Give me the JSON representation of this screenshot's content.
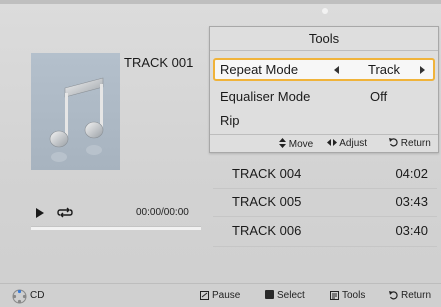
{
  "now_playing": {
    "track_title": "TRACK 001",
    "time": "00:00/00:00",
    "progress": 0
  },
  "tracks": [
    {
      "name": "TRACK 004",
      "duration": "04:02"
    },
    {
      "name": "TRACK 005",
      "duration": "03:43"
    },
    {
      "name": "TRACK 006",
      "duration": "03:40"
    }
  ],
  "tools_popup": {
    "title": "Tools",
    "items": [
      {
        "label": "Repeat Mode",
        "value": "Track"
      },
      {
        "label": "Equaliser Mode",
        "value": "Off"
      },
      {
        "label": "Rip",
        "value": ""
      }
    ],
    "footer": {
      "move": "Move",
      "adjust": "Adjust",
      "return": "Return"
    }
  },
  "bottom_bar": {
    "source": "CD",
    "pause": "Pause",
    "select": "Select",
    "tools": "Tools",
    "return": "Return"
  },
  "colors": {
    "highlight_border": "#f0b33a",
    "album_art_bg": "#b4c0cc"
  },
  "icons": {
    "album_art": "music-note-icon",
    "play": "play-icon",
    "repeat": "repeat-icon"
  }
}
